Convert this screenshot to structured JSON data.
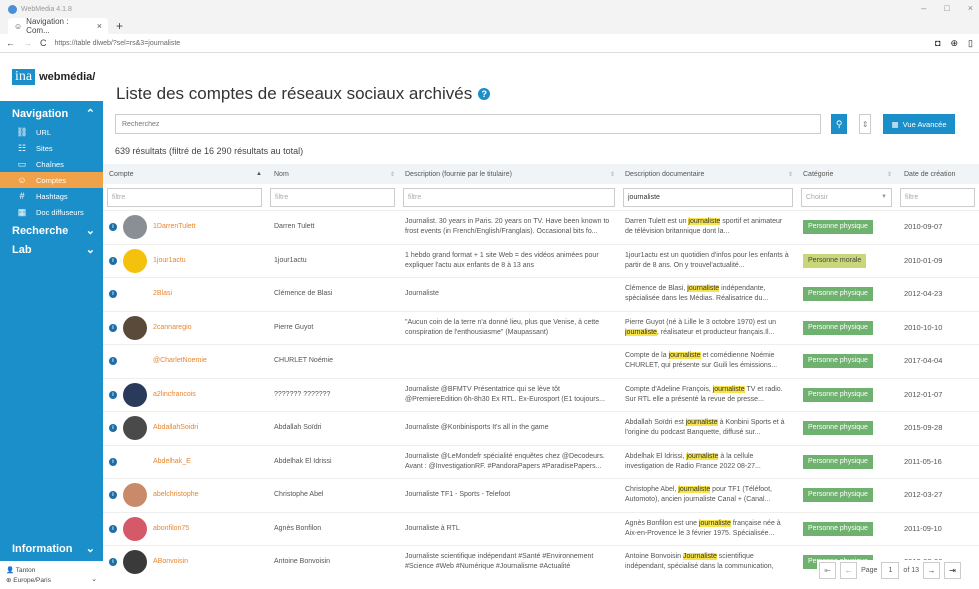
{
  "window": {
    "title": "WebMedia 4.1.8",
    "tab_label": "Navigation : Com...",
    "tab_close": "×",
    "new_tab": "+",
    "url": "https://table dlweb/?sel=rs&3=journaliste",
    "controls": [
      "–",
      "□",
      "×"
    ]
  },
  "sidebar": {
    "logo_ina": "ina",
    "logo_brand": "webmédia/",
    "nav_title": "Navigation",
    "items": [
      {
        "label": "URL",
        "icon": "link-icon",
        "glyph": "⛓"
      },
      {
        "label": "Sites",
        "icon": "sitemap-icon",
        "glyph": "☷"
      },
      {
        "label": "Chaînes",
        "icon": "tv-icon",
        "glyph": "▭"
      },
      {
        "label": "Comptes",
        "icon": "users-icon",
        "glyph": "☺"
      },
      {
        "label": "Hashtags",
        "icon": "hashtag-icon",
        "glyph": "#"
      },
      {
        "label": "Doc diffuseurs",
        "icon": "building-icon",
        "glyph": "▦"
      }
    ],
    "recherche": "Recherche",
    "lab": "Lab",
    "information": "Information",
    "user_name": "Tanton",
    "user_tz": "Europe/Paris"
  },
  "main": {
    "title": "Liste des comptes de réseaux sociaux archivés",
    "search_placeholder": "Recherchez",
    "advanced_label": "Vue Avancée",
    "results": "639 résultats (filtré de 16 290 résultats au total)"
  },
  "table": {
    "headers": {
      "compte": "Compte",
      "nom": "Nom",
      "desc": "Description (fournie par le titulaire)",
      "doc": "Description documentaire",
      "cat": "Catégorie",
      "date": "Date de création"
    },
    "filters": {
      "compte": "filtre",
      "nom": "filtre",
      "desc": "filtre",
      "doc": "journaliste",
      "cat": "Choisir",
      "date": "filtre"
    },
    "rows": [
      {
        "handle": "1DarrenTulett",
        "avatar": "#8a8f95",
        "nom": "Darren Tulett",
        "desc": "Journalist. 30 years in Paris. 20 years on TV. Have been known to frost events (in French/English/Franglais). Occasional bits fo...",
        "doc_pre": "Darren Tulett est un ",
        "doc_mark": "journaliste",
        "doc_post": " sportif et animateur de télévision britannique dont la...",
        "cat": "Personne physique",
        "cat_type": "phys",
        "date": "2010-09-07"
      },
      {
        "handle": "1jour1actu",
        "avatar": "#f4c20d",
        "nom": "1jour1actu",
        "desc": "1 hebdo grand format + 1 site Web = des vidéos animées pour expliquer l'actu aux enfants de 8 à 13 ans",
        "doc_pre": "1jour1actu est un quotidien d'infos pour les enfants à partir de 8 ans. On y trouvel'actualité...",
        "doc_mark": "",
        "doc_post": "",
        "cat": "Personne morale",
        "cat_type": "morale",
        "date": "2010-01-09"
      },
      {
        "handle": "2Blasi",
        "avatar": "#ffffff",
        "nom": "Clémence de Blasi",
        "desc": "Journaliste",
        "doc_pre": "Clémence de Blasi, ",
        "doc_mark": "journaliste",
        "doc_post": " indépendante, spécialisée dans les Médias. Réalisatrice du...",
        "cat": "Personne physique",
        "cat_type": "phys",
        "date": "2012-04-23"
      },
      {
        "handle": "2cannaregio",
        "avatar": "#5a4a3a",
        "nom": "Pierre Guyot",
        "desc": "\"Aucun coin de la terre n'a donné lieu, plus que Venise, à cette conspiration de l'enthousiasme\" (Maupassant)",
        "doc_pre": "Pierre Guyot (né à Lille le 3 octobre 1970) est un ",
        "doc_mark": "journaliste",
        "doc_post": ", réalisateur et producteur français.Il...",
        "cat": "Personne physique",
        "cat_type": "phys",
        "date": "2010-10-10"
      },
      {
        "handle": "@CharletNoemie",
        "avatar": "#ffffff",
        "nom": "CHURLET Noémie",
        "desc": "",
        "doc_pre": "Compte de la ",
        "doc_mark": "journaliste",
        "doc_post": " et comédienne Noémie CHURLET, qui présente sur Guili les émissions...",
        "cat": "Personne physique",
        "cat_type": "phys",
        "date": "2017-04-04"
      },
      {
        "handle": "a2lincfrancois",
        "avatar": "#2a3a5a",
        "nom": "??????? ???????",
        "desc": "Journaliste @BFMTV Présentatrice qui se lève tôt @PremiereEdition 6h-8h30 Ex RTL. Ex-Eurosport (E1 toujours...",
        "doc_pre": "Compte d'Adeline François, ",
        "doc_mark": "journaliste",
        "doc_post": " TV et radio. Sur RTL elle a présenté la revue de presse...",
        "cat": "Personne physique",
        "cat_type": "phys",
        "date": "2012-01-07"
      },
      {
        "handle": "AbdallahSoidri",
        "avatar": "#4a4a4a",
        "nom": "Abdallah Soïdri",
        "desc": "Journaliste @Konbinisports It's all in the game",
        "doc_pre": "Abdallah Soïdri est ",
        "doc_mark": "journaliste",
        "doc_post": " à Konbini Sports et à l'origine du podcast Banquette, diffusé sur...",
        "cat": "Personne physique",
        "cat_type": "phys",
        "date": "2015-09-28"
      },
      {
        "handle": "Abdelhak_E",
        "avatar": "#ffffff",
        "nom": "Abdelhak El Idrissi",
        "desc": "Journaliste @LeMondefr spécialité enquêtes chez @Decodeurs. Avant : @InvestigationRF. #PandoraPapers #ParadisePapers...",
        "doc_pre": "Abdelhak El Idrissi, ",
        "doc_mark": "journaliste",
        "doc_post": " à la cellule investigation de Radio France 2022 08-27...",
        "cat": "Personne physique",
        "cat_type": "phys",
        "date": "2011-05-16"
      },
      {
        "handle": "abelchristophe",
        "avatar": "#c98a6a",
        "nom": "Christophe Abel",
        "desc": "Journaliste TF1 - Sports - Telefoot",
        "doc_pre": "Christophe Abel, ",
        "doc_mark": "journaliste",
        "doc_post": " pour TF1 (Téléfoot, Automoto), ancien journaliste Canal + (Canal...",
        "cat": "Personne physique",
        "cat_type": "phys",
        "date": "2012-03-27"
      },
      {
        "handle": "abonfilon75",
        "avatar": "#d45a6a",
        "nom": "Agnès Bonfilon",
        "desc": "Journaliste à RTL",
        "doc_pre": "Agnès Bonfilon est une ",
        "doc_mark": "journaliste",
        "doc_post": " française née à Aix-en-Provence le 3 février 1975. Spécialisée...",
        "cat": "Personne physique",
        "cat_type": "phys",
        "date": "2011-09-10"
      },
      {
        "handle": "ABonvoisin",
        "avatar": "#3a3a3a",
        "nom": "Antoine Bonvoisin",
        "desc": "Journaliste scientifique indépendant #Santé #Environnement #Science #Web #Numérique #Journalisme #Actualité",
        "doc_pre": "Antoine Bonvoisin ",
        "doc_mark": "Journaliste",
        "doc_post": " scientifique indépendant, spécialisé dans la communication,",
        "cat": "Personne physique",
        "cat_type": "phys",
        "date": "2013-03-06"
      }
    ]
  },
  "pager": {
    "page_label": "Page",
    "page": "1",
    "of": "of 13"
  },
  "colors": {
    "accent": "#1b8fc9",
    "active": "#f0a24a",
    "handle": "#e8862e",
    "badge_phys": "#6fb16e",
    "badge_morale": "#c9d77a",
    "highlight": "#f7e34b"
  }
}
